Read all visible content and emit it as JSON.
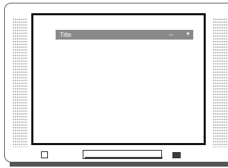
{
  "screen": {
    "title_field": {
      "label": "Title",
      "value": "--",
      "arrow": "▼"
    }
  },
  "icons": {
    "speaker_left": "speaker-grille",
    "speaker_right": "speaker-grille",
    "arrow": "dropdown-arrow"
  },
  "colors": {
    "title_bar_bg": "#8a8a8a",
    "screen_border": "#111111",
    "dark_button": "#3a3a3a"
  }
}
